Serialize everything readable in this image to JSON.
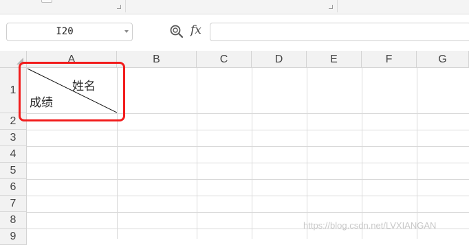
{
  "namebox": {
    "value": "I20"
  },
  "formula_bar": {
    "fx_label": "fx",
    "value": ""
  },
  "columns": [
    "A",
    "B",
    "C",
    "D",
    "E",
    "F",
    "G"
  ],
  "rows": [
    "1",
    "2",
    "3",
    "4",
    "5",
    "6",
    "7",
    "8",
    "9"
  ],
  "cell_A1": {
    "upper_text": "姓名",
    "lower_text": "成绩"
  },
  "watermark": "https://blog.csdn.net/LVXIANGAN"
}
